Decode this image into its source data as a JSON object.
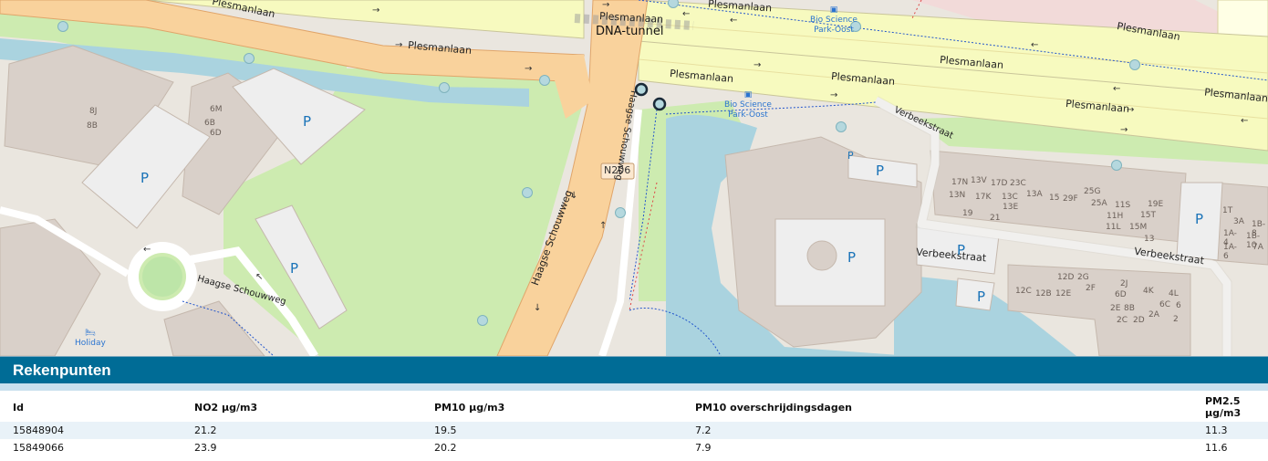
{
  "map": {
    "roads": {
      "plesmanlaan": "Plesmanlaan",
      "haagse_schouwweg": "Haagse Schouwweg",
      "verbeekstraat": "Verbeekstraat",
      "tunnel": "DNA-tunnel",
      "route_shield": "N206"
    },
    "stops": {
      "stop1_line1": "Bio Science",
      "stop1_line2": "Park-Oost",
      "stop2_line1": "Bio Science",
      "stop2_line2": "Park-Oost"
    },
    "poi": {
      "holiday": "Holiday"
    },
    "parking_symbol": "P",
    "house_numbers": [
      "8J",
      "8B",
      "6M",
      "6B",
      "6D",
      "17N",
      "13V",
      "17D",
      "23C",
      "13N",
      "17K",
      "13C",
      "13A",
      "15",
      "29F",
      "25G",
      "13E",
      "25A",
      "11S",
      "19E",
      "19",
      "21",
      "15T",
      "11H",
      "15M",
      "11L",
      "13",
      "1T",
      "3A",
      "1B-8",
      "1A-4",
      "1B-10",
      "1A-6",
      "7A",
      "12D",
      "2G",
      "2J",
      "2F",
      "12C",
      "12B",
      "12E",
      "6D",
      "4K",
      "4L",
      "2E",
      "8B",
      "6C",
      "6",
      "2C",
      "2D",
      "2A",
      "2"
    ],
    "colors": {
      "motorway": "#f9d29c",
      "road_yellow": "#f7fabf",
      "grass": "#cdebb0",
      "water": "#aad3df",
      "building": "#d9d0c9",
      "parking": "#eeeeee",
      "measure_point": "#b5d8de"
    }
  },
  "panel": {
    "title": "Rekenpunten",
    "columns": [
      "Id",
      "NO2 µg/m3",
      "PM10 µg/m3",
      "PM10 overschrijdingsdagen",
      "PM2.5 µg/m3"
    ],
    "rows": [
      [
        "15848904",
        "21.2",
        "19.5",
        "7.2",
        "11.3"
      ],
      [
        "15849066",
        "23.9",
        "20.2",
        "7.9",
        "11.6"
      ]
    ]
  }
}
